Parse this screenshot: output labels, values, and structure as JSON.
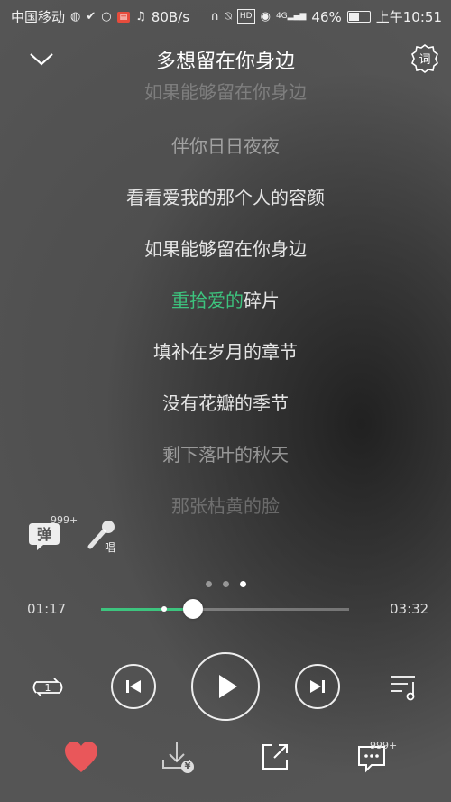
{
  "status_bar": {
    "carrier": "中国移动",
    "speed": "80B/s",
    "signal_label": "4G",
    "battery": "46%",
    "time": "上午10:51"
  },
  "header": {
    "title": "多想留在你身边",
    "lyric_button_label": "词"
  },
  "lyrics": {
    "lines": [
      "如果能够留在你身边",
      "伴你日日夜夜",
      "看看爱我的那个人的容颜",
      "如果能够留在你身边",
      "碎片",
      "填补在岁月的章节",
      "没有花瓣的季节",
      "剩下落叶的秋天",
      "那张枯黄的脸"
    ],
    "current_sung": "重拾爱的",
    "current_line_index": 4
  },
  "side_actions": {
    "danmu_label": "弹",
    "danmu_count": "999+",
    "sing_label": "唱"
  },
  "pager": {
    "pages": 3,
    "active": 2
  },
  "progress": {
    "elapsed": "01:17",
    "duration": "03:32",
    "played_fraction": 0.37,
    "buffered_fraction": 0.255
  },
  "controls": {
    "repeat_mode_badge": "1"
  },
  "bottom_bar": {
    "download_price_symbol": "¥",
    "comment_count": "999+"
  },
  "colors": {
    "accent": "#3dc47e",
    "favorite": "#e9575a"
  },
  "icons": [
    "chevron-down-icon",
    "lyric-settings-icon",
    "danmu-icon",
    "microphone-icon",
    "repeat-one-icon",
    "previous-icon",
    "play-icon",
    "next-icon",
    "playlist-icon",
    "heart-icon",
    "download-icon",
    "share-icon",
    "comment-icon"
  ]
}
